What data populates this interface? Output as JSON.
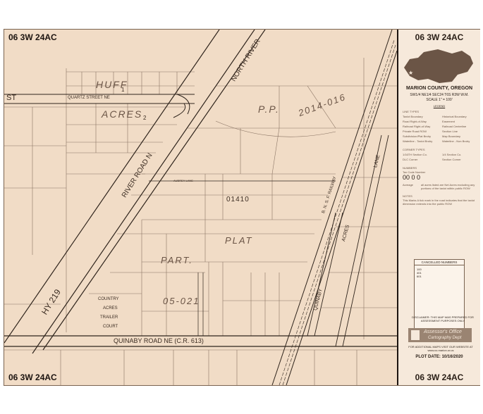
{
  "header": {
    "map_number": "06 3W 24AC"
  },
  "map": {
    "streets": {
      "st_label": "ST",
      "quartz_street": "QUARTZ STREET NE",
      "river_road": "RIVER ROAD N",
      "north_river": "NORTH RIVER",
      "hy219": "HY 219",
      "quinaby_road": "QUINABY ROAD NE  (C.R. 613)",
      "quinaby": "QUINABY",
      "acres": "ACRES",
      "lane": "LANE",
      "railway": "B. N. S. F. RAILWAY",
      "aubrey_lane": "AUBREY LANE"
    },
    "subdivisions": {
      "huff": "HUFF",
      "acres": "ACRES",
      "pp": "P.P.",
      "pp_number": "2014-016",
      "part": "PART.",
      "plat": "PLAT",
      "plat_number": "05-021",
      "country": "COUNTRY",
      "country_acres": "ACRES",
      "trailer": "TRAILER",
      "court": "COURT"
    },
    "code_area": "01410",
    "lot_numbers": [
      "1",
      "2"
    ]
  },
  "panel": {
    "title": "06 3W 24AC",
    "county": "MARION COUNTY, OREGON",
    "location": "SW1/4 NE1/4 SEC24 T6S R3W W.M.",
    "scale": "SCALE   1\" = 100'",
    "legend_title": "LEGEND",
    "line_types_title": "LINE TYPES",
    "line_types": [
      [
        "Taxlot Boundary",
        "Historical Boundary"
      ],
      [
        "Road Right-of-Way",
        "Easement"
      ],
      [
        "Railroad Right-of-Way",
        "Railroad Centerline"
      ],
      [
        "Private Road ROW",
        "Section Line"
      ],
      [
        "Subdivision/Plat Bndry",
        "Map Boundary"
      ],
      [
        "Waterline - Taxlot Bndry",
        "Waterline - Non Bndry"
      ]
    ],
    "corner_types_title": "CORNER TYPES",
    "corner_types": [
      [
        "1/16TH Section Co.",
        "1/4 Section Co."
      ],
      [
        "DLC Corner",
        "Section Corner"
      ]
    ],
    "numbers_title": "NUMBERS",
    "tax_code_label": "Tax Code Number",
    "tax_code": "00 0 0",
    "acreage_label": "Acreage",
    "acreage_note": "all acres listed are Net Acres excluding any portions of the taxlot within public ROW",
    "notes_title": "NOTES",
    "notes_text": "This Marks   A tick mark in the road indicates that the taxlot dimension extends into the public ROW",
    "cancelled_title": "CANCELLED NUMBERS",
    "cancelled_numbers": [
      "100",
      "401",
      "601"
    ],
    "disclaimer": "DISCLAIMER:  THIS MAP WAS PREPARED FOR ASSESSMENT PURPOSES ONLY",
    "office": "Assessor's Office",
    "dept": "Cartography Dept",
    "more_maps": "FOR ADDITIONAL MAPS VISIT OUR WEBSITE AT www.co.marion.or.us",
    "plot_date": "PLOT DATE: 10/16/2020"
  },
  "colors": {
    "paper": "#f1dcc6",
    "ink": "#2a1f17",
    "county_fill": "#6b5546"
  }
}
